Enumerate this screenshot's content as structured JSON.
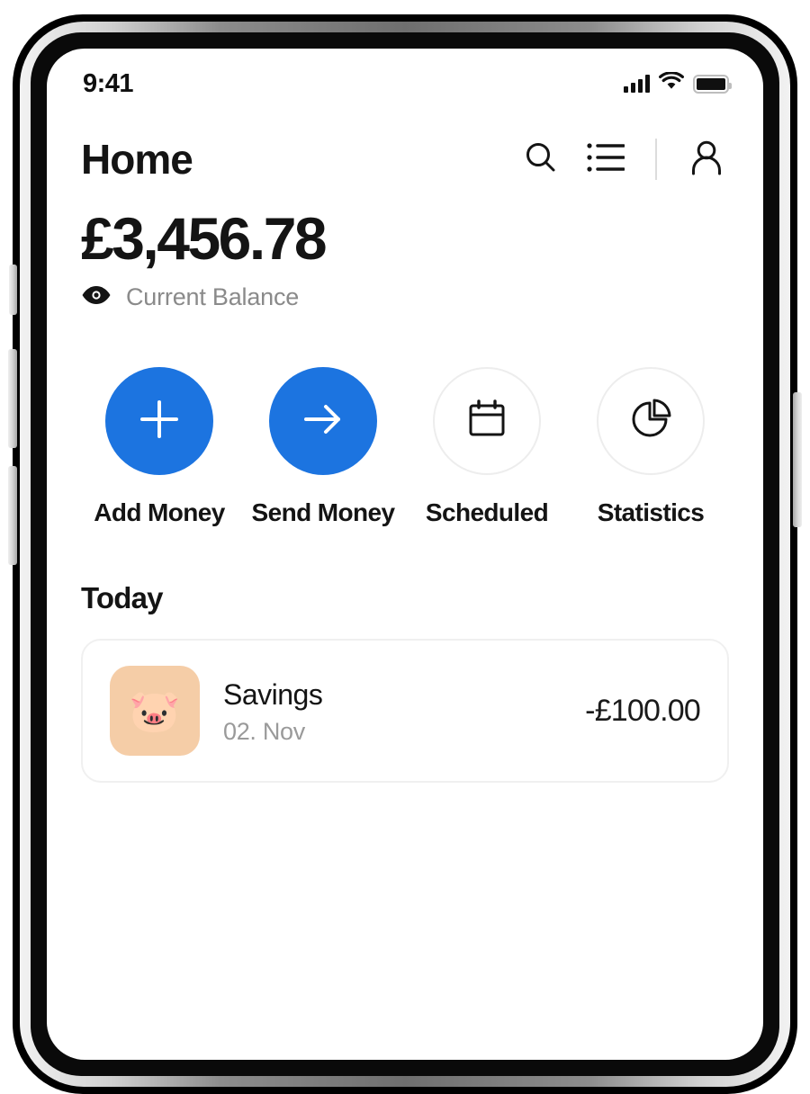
{
  "status_bar": {
    "time": "9:41",
    "cellular_icon": "signal-bars-icon",
    "wifi_icon": "wifi-icon",
    "battery_icon": "battery-full-icon"
  },
  "header": {
    "title": "Home",
    "actions": [
      {
        "name": "search-icon",
        "label": "Search"
      },
      {
        "name": "list-icon",
        "label": "Transactions list"
      },
      {
        "name": "profile-icon",
        "label": "Profile"
      }
    ]
  },
  "balance": {
    "amount": "£3,456.78",
    "label": "Current Balance",
    "visibility_icon": "eye-icon"
  },
  "quick_actions": [
    {
      "label": "Add Money",
      "icon": "plus-icon",
      "style": "filled"
    },
    {
      "label": "Send Money",
      "icon": "arrow-right-icon",
      "style": "filled"
    },
    {
      "label": "Scheduled",
      "icon": "calendar-icon",
      "style": "outline"
    },
    {
      "label": "Statistics",
      "icon": "pie-chart-icon",
      "style": "outline"
    }
  ],
  "transactions": {
    "section_title": "Today",
    "items": [
      {
        "name": "Savings",
        "date": "02. Nov",
        "amount": "-£100.00",
        "avatar_emoji": "🐷",
        "avatar_icon": "piggy-bank-icon"
      }
    ]
  },
  "colors": {
    "accent_blue": "#1C74E0",
    "avatar_peach": "#F5CDA7",
    "text_primary": "#141414",
    "text_muted": "#8A8A8A",
    "border_light": "#EDEDED"
  }
}
